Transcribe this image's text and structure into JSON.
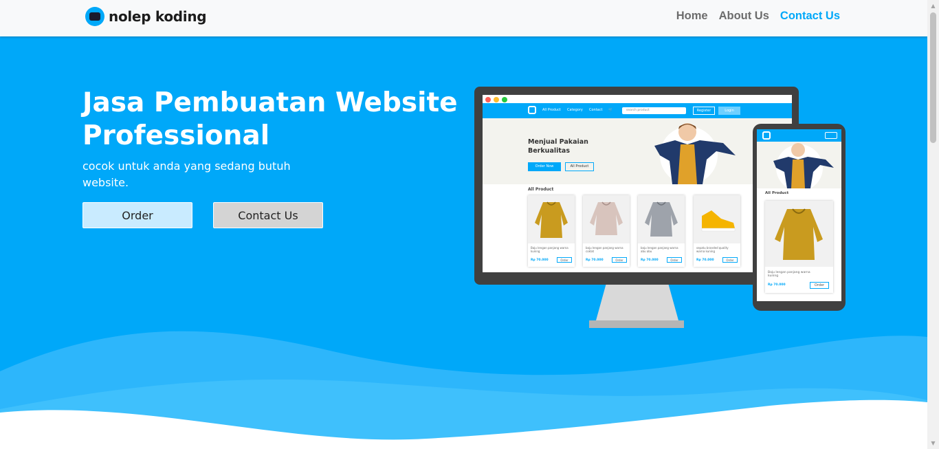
{
  "navbar": {
    "brand": "nolep koding",
    "links": [
      {
        "label": "Home",
        "active": false
      },
      {
        "label": "About Us",
        "active": false
      },
      {
        "label": "Contact Us",
        "active": true
      }
    ]
  },
  "hero": {
    "title": "Jasa Pembuatan Website Professional",
    "subtitle": "cocok untuk anda yang sedang butuh website.",
    "order_button": "Order",
    "contact_button": "Contact Us"
  },
  "illustration": {
    "nav": {
      "links": [
        "All Product",
        "Category",
        "Contact"
      ],
      "search_placeholder": "search product",
      "register": "Register",
      "login": "Login"
    },
    "banner": {
      "title": "Menjual Pakaian Berkualitas",
      "primary_button": "Order Now",
      "secondary_button": "All Product"
    },
    "section_heading": "All Product",
    "products": [
      {
        "desc": "Baju lengan panjang warna kuning",
        "price": "Rp 70.000",
        "button": "Order"
      },
      {
        "desc": "baju lengan panjang warna coklat",
        "price": "Rp 70.000",
        "button": "Order"
      },
      {
        "desc": "baju lengan panjang warna abu abu",
        "price": "Rp 70.000",
        "button": "Order"
      },
      {
        "desc": "sepatu branded quality warna kuning",
        "price": "Rp 70.000",
        "button": "Order"
      }
    ],
    "phone_heading": "All Product",
    "phone_product": {
      "desc": "Baju lengan panjang warna kuning",
      "price": "Rp 70.000",
      "button": "Order"
    }
  },
  "colors": {
    "primary": "#00a8f9",
    "nav_bg": "#f8f9fa",
    "wave_light": "#33b9fb",
    "wave_mid": "#2db6fb"
  }
}
